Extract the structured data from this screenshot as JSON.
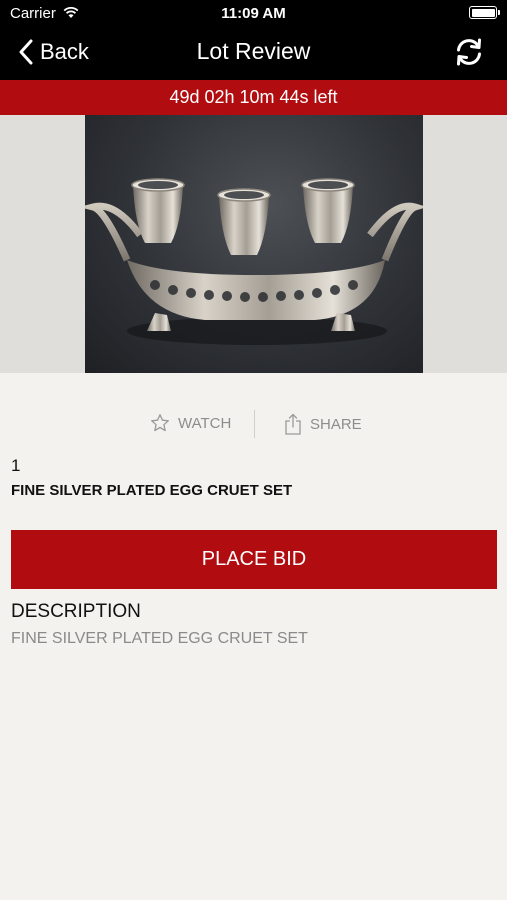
{
  "status_bar": {
    "carrier": "Carrier",
    "time": "11:09 AM"
  },
  "nav": {
    "back_label": "Back",
    "title": "Lot Review",
    "back_icon": "chevron-left-icon",
    "refresh_icon": "refresh-icon"
  },
  "timer": {
    "text": "49d 02h 10m 44s left"
  },
  "actions": {
    "watch_label": "WATCH",
    "watch_icon": "star-icon",
    "share_label": "SHARE",
    "share_icon": "share-icon"
  },
  "lot": {
    "number": "1",
    "title": "FINE SILVER PLATED EGG CRUET SET"
  },
  "bid": {
    "button_label": "PLACE BID"
  },
  "description": {
    "heading": "DESCRIPTION",
    "text": "FINE SILVER PLATED EGG CRUET SET"
  },
  "colors": {
    "accent_red": "#b10d10",
    "header_black": "#000000",
    "background": "#f3f2ee"
  }
}
